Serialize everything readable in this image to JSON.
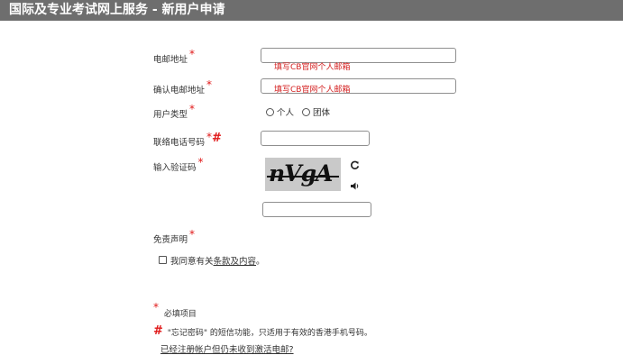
{
  "header": {
    "title": "国际及专业考试网上服务 - 新用户申请"
  },
  "form": {
    "email_label": "电邮地址",
    "email_hint": "填写CB官网个人邮箱",
    "confirm_email_label": "确认电邮地址",
    "confirm_email_hint": "填写CB官网个人邮箱",
    "user_type_label": "用户类型",
    "user_type_options": [
      "个人",
      "团体"
    ],
    "phone_label": "联络电话号码",
    "captcha_label": "输入验证码",
    "captcha_text": "nVgA",
    "disclaimer_label": "免责声明",
    "agree_prefix": "我同意有关",
    "agree_link": "条款及内容",
    "agree_suffix": "。",
    "required_mark": "*",
    "hash_mark": "#"
  },
  "notes": {
    "required_note": "必填项目",
    "sms_note": "\"忘记密码\" 的短信功能，只适用于有效的香港手机号码。",
    "activation_link": "已经注册帐户但仍未收到激活电邮?"
  },
  "icons": {
    "refresh": "refresh-icon",
    "audio": "speaker-icon"
  },
  "colors": {
    "header_bg": "#6e6e6e",
    "required": "#e01818",
    "hint": "#d42020"
  }
}
